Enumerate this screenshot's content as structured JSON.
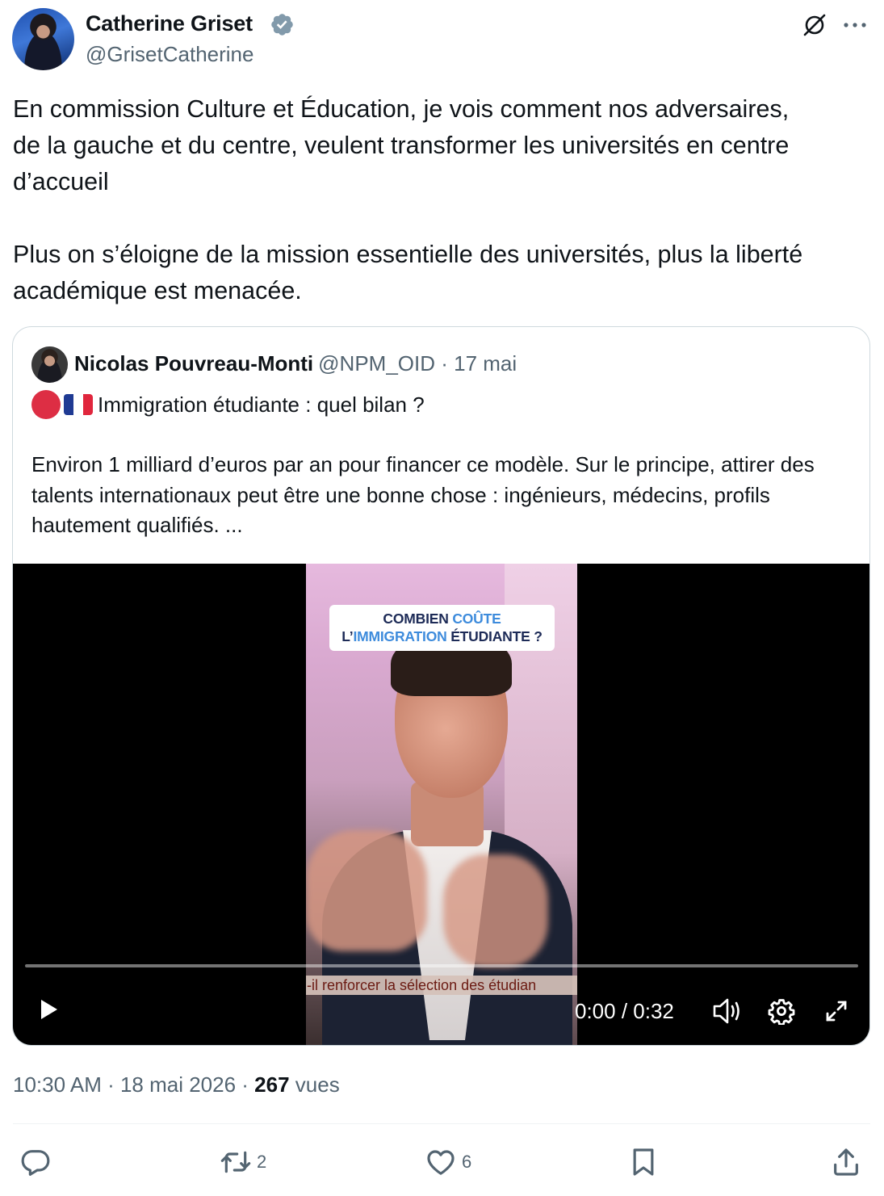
{
  "author": {
    "name": "Catherine Griset",
    "handle": "@GrisetCatherine"
  },
  "tweet": {
    "paragraphs": [
      "En commission Culture et Éducation, je vois comment nos adversaires,\nde la gauche et du centre, veulent transformer les universités en centre\nd’accueil",
      "Plus on s’éloigne de la mission essentielle des universités, plus la liberté\nacadémique est menacée."
    ]
  },
  "quote": {
    "name": "Nicolas Pouvreau-Monti",
    "meta": "@NPM_OID · 17 mai",
    "title": "Immigration étudiante : quel bilan ?",
    "text": "Environ 1 milliard d’euros par an pour financer ce modèle. Sur le principe, attirer des talents internationaux peut être une bonne chose : ingénieurs, médecins, profils hautement qualifiés. ...",
    "video": {
      "overlay_line1_a": "COMBIEN ",
      "overlay_line1_b": "COÛTE",
      "overlay_line2_a": "L’",
      "overlay_line2_b": "IMMIGRATION",
      "overlay_line2_c": " ÉTUDIANTE ?",
      "subtitle": "-il renforcer la sélection des étudian",
      "time": "0:00 / 0:32",
      "progress": 0
    }
  },
  "footer": {
    "time": "10:30 AM · 18 mai 2026 · ",
    "views_count": "267",
    "views_label": " vues"
  },
  "actions": {
    "reply_count": "",
    "retweet_count": "2",
    "like_count": "6"
  },
  "colors": {
    "text": "#0f1419",
    "muted": "#536471",
    "verified": "#829aab",
    "border": "#cfd9de"
  }
}
